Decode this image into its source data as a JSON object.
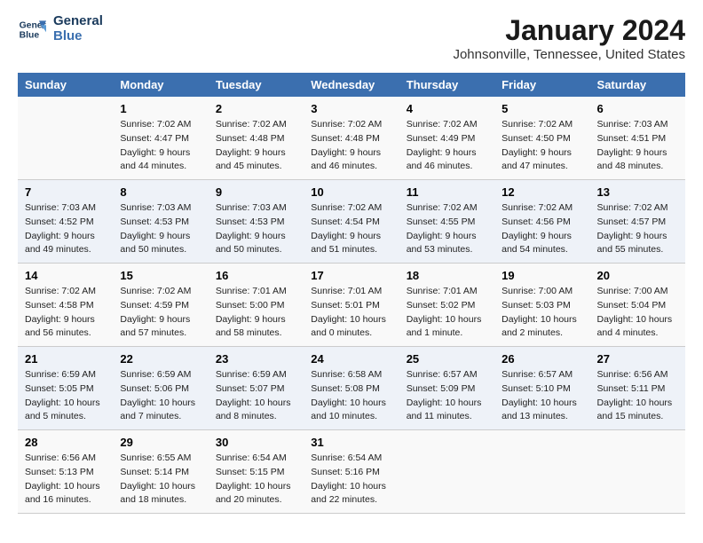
{
  "header": {
    "logo_line1": "General",
    "logo_line2": "Blue",
    "month": "January 2024",
    "location": "Johnsonville, Tennessee, United States"
  },
  "days_of_week": [
    "Sunday",
    "Monday",
    "Tuesday",
    "Wednesday",
    "Thursday",
    "Friday",
    "Saturday"
  ],
  "weeks": [
    [
      {
        "num": "",
        "sunrise": "",
        "sunset": "",
        "daylight": ""
      },
      {
        "num": "1",
        "sunrise": "Sunrise: 7:02 AM",
        "sunset": "Sunset: 4:47 PM",
        "daylight": "Daylight: 9 hours and 44 minutes."
      },
      {
        "num": "2",
        "sunrise": "Sunrise: 7:02 AM",
        "sunset": "Sunset: 4:48 PM",
        "daylight": "Daylight: 9 hours and 45 minutes."
      },
      {
        "num": "3",
        "sunrise": "Sunrise: 7:02 AM",
        "sunset": "Sunset: 4:48 PM",
        "daylight": "Daylight: 9 hours and 46 minutes."
      },
      {
        "num": "4",
        "sunrise": "Sunrise: 7:02 AM",
        "sunset": "Sunset: 4:49 PM",
        "daylight": "Daylight: 9 hours and 46 minutes."
      },
      {
        "num": "5",
        "sunrise": "Sunrise: 7:02 AM",
        "sunset": "Sunset: 4:50 PM",
        "daylight": "Daylight: 9 hours and 47 minutes."
      },
      {
        "num": "6",
        "sunrise": "Sunrise: 7:03 AM",
        "sunset": "Sunset: 4:51 PM",
        "daylight": "Daylight: 9 hours and 48 minutes."
      }
    ],
    [
      {
        "num": "7",
        "sunrise": "Sunrise: 7:03 AM",
        "sunset": "Sunset: 4:52 PM",
        "daylight": "Daylight: 9 hours and 49 minutes."
      },
      {
        "num": "8",
        "sunrise": "Sunrise: 7:03 AM",
        "sunset": "Sunset: 4:53 PM",
        "daylight": "Daylight: 9 hours and 50 minutes."
      },
      {
        "num": "9",
        "sunrise": "Sunrise: 7:03 AM",
        "sunset": "Sunset: 4:53 PM",
        "daylight": "Daylight: 9 hours and 50 minutes."
      },
      {
        "num": "10",
        "sunrise": "Sunrise: 7:02 AM",
        "sunset": "Sunset: 4:54 PM",
        "daylight": "Daylight: 9 hours and 51 minutes."
      },
      {
        "num": "11",
        "sunrise": "Sunrise: 7:02 AM",
        "sunset": "Sunset: 4:55 PM",
        "daylight": "Daylight: 9 hours and 53 minutes."
      },
      {
        "num": "12",
        "sunrise": "Sunrise: 7:02 AM",
        "sunset": "Sunset: 4:56 PM",
        "daylight": "Daylight: 9 hours and 54 minutes."
      },
      {
        "num": "13",
        "sunrise": "Sunrise: 7:02 AM",
        "sunset": "Sunset: 4:57 PM",
        "daylight": "Daylight: 9 hours and 55 minutes."
      }
    ],
    [
      {
        "num": "14",
        "sunrise": "Sunrise: 7:02 AM",
        "sunset": "Sunset: 4:58 PM",
        "daylight": "Daylight: 9 hours and 56 minutes."
      },
      {
        "num": "15",
        "sunrise": "Sunrise: 7:02 AM",
        "sunset": "Sunset: 4:59 PM",
        "daylight": "Daylight: 9 hours and 57 minutes."
      },
      {
        "num": "16",
        "sunrise": "Sunrise: 7:01 AM",
        "sunset": "Sunset: 5:00 PM",
        "daylight": "Daylight: 9 hours and 58 minutes."
      },
      {
        "num": "17",
        "sunrise": "Sunrise: 7:01 AM",
        "sunset": "Sunset: 5:01 PM",
        "daylight": "Daylight: 10 hours and 0 minutes."
      },
      {
        "num": "18",
        "sunrise": "Sunrise: 7:01 AM",
        "sunset": "Sunset: 5:02 PM",
        "daylight": "Daylight: 10 hours and 1 minute."
      },
      {
        "num": "19",
        "sunrise": "Sunrise: 7:00 AM",
        "sunset": "Sunset: 5:03 PM",
        "daylight": "Daylight: 10 hours and 2 minutes."
      },
      {
        "num": "20",
        "sunrise": "Sunrise: 7:00 AM",
        "sunset": "Sunset: 5:04 PM",
        "daylight": "Daylight: 10 hours and 4 minutes."
      }
    ],
    [
      {
        "num": "21",
        "sunrise": "Sunrise: 6:59 AM",
        "sunset": "Sunset: 5:05 PM",
        "daylight": "Daylight: 10 hours and 5 minutes."
      },
      {
        "num": "22",
        "sunrise": "Sunrise: 6:59 AM",
        "sunset": "Sunset: 5:06 PM",
        "daylight": "Daylight: 10 hours and 7 minutes."
      },
      {
        "num": "23",
        "sunrise": "Sunrise: 6:59 AM",
        "sunset": "Sunset: 5:07 PM",
        "daylight": "Daylight: 10 hours and 8 minutes."
      },
      {
        "num": "24",
        "sunrise": "Sunrise: 6:58 AM",
        "sunset": "Sunset: 5:08 PM",
        "daylight": "Daylight: 10 hours and 10 minutes."
      },
      {
        "num": "25",
        "sunrise": "Sunrise: 6:57 AM",
        "sunset": "Sunset: 5:09 PM",
        "daylight": "Daylight: 10 hours and 11 minutes."
      },
      {
        "num": "26",
        "sunrise": "Sunrise: 6:57 AM",
        "sunset": "Sunset: 5:10 PM",
        "daylight": "Daylight: 10 hours and 13 minutes."
      },
      {
        "num": "27",
        "sunrise": "Sunrise: 6:56 AM",
        "sunset": "Sunset: 5:11 PM",
        "daylight": "Daylight: 10 hours and 15 minutes."
      }
    ],
    [
      {
        "num": "28",
        "sunrise": "Sunrise: 6:56 AM",
        "sunset": "Sunset: 5:13 PM",
        "daylight": "Daylight: 10 hours and 16 minutes."
      },
      {
        "num": "29",
        "sunrise": "Sunrise: 6:55 AM",
        "sunset": "Sunset: 5:14 PM",
        "daylight": "Daylight: 10 hours and 18 minutes."
      },
      {
        "num": "30",
        "sunrise": "Sunrise: 6:54 AM",
        "sunset": "Sunset: 5:15 PM",
        "daylight": "Daylight: 10 hours and 20 minutes."
      },
      {
        "num": "31",
        "sunrise": "Sunrise: 6:54 AM",
        "sunset": "Sunset: 5:16 PM",
        "daylight": "Daylight: 10 hours and 22 minutes."
      },
      {
        "num": "",
        "sunrise": "",
        "sunset": "",
        "daylight": ""
      },
      {
        "num": "",
        "sunrise": "",
        "sunset": "",
        "daylight": ""
      },
      {
        "num": "",
        "sunrise": "",
        "sunset": "",
        "daylight": ""
      }
    ]
  ]
}
